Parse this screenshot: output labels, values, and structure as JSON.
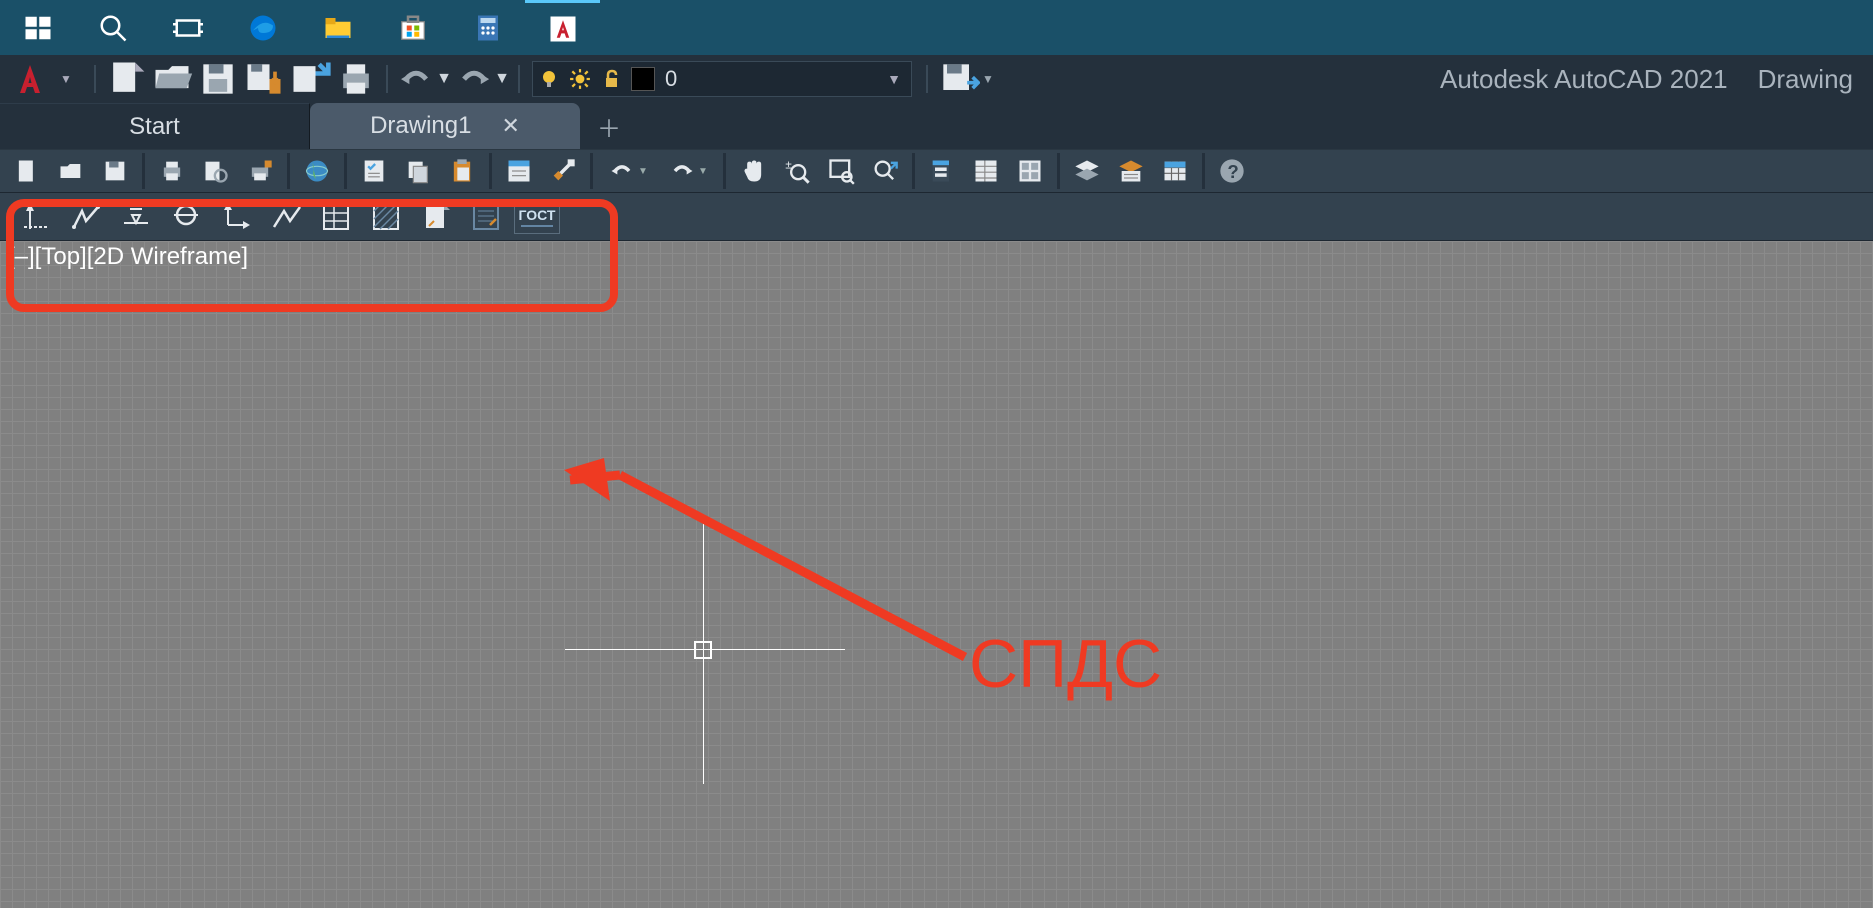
{
  "taskbar": {
    "items": [
      {
        "name": "start",
        "icon": "windows"
      },
      {
        "name": "search",
        "icon": "search"
      },
      {
        "name": "task-view",
        "icon": "taskview"
      },
      {
        "name": "edge",
        "icon": "edge"
      },
      {
        "name": "explorer",
        "icon": "folder"
      },
      {
        "name": "store",
        "icon": "store"
      },
      {
        "name": "calculator",
        "icon": "calc"
      },
      {
        "name": "autocad",
        "icon": "autocad",
        "highlighted": true
      }
    ]
  },
  "menubar": {
    "app": "AutoCAD",
    "qat": [
      "new",
      "open",
      "save",
      "save-all",
      "export-open",
      "print",
      "undo",
      "redo"
    ],
    "layer": {
      "bulb": "on",
      "sun": "thawed",
      "lock": "unlocked",
      "color": "#000000",
      "name": "0"
    },
    "share_icon": "open-share",
    "title_app": "Autodesk AutoCAD 2021",
    "title_doc": "Drawing"
  },
  "tabs": {
    "start_label": "Start",
    "drawing_label": "Drawing1"
  },
  "toolbar1": [
    "new-doc",
    "open-doc",
    "save-doc",
    "print",
    "print-preview",
    "plot-styles",
    "globe",
    "check-list",
    "copy-clip",
    "paste",
    "properties",
    "match-props",
    "undo",
    "redo",
    "pan",
    "zoom-extents",
    "zoom-window",
    "zoom-realtime",
    "tool-palettes",
    "properties-panel",
    "sheet-set",
    "layers",
    "layer-state",
    "table",
    "help"
  ],
  "toolbar2": [
    "axis-line",
    "break-line",
    "level-mark",
    "circle-mark",
    "section-mark",
    "welding",
    "spec-table",
    "hatch-aux",
    "page-aux",
    "form-aux"
  ],
  "toolbar2_gost": "ГОСТ",
  "canvas": {
    "viewport_label": "[–][Top][2D Wireframe]"
  },
  "annotation": {
    "label": "СПДС"
  }
}
